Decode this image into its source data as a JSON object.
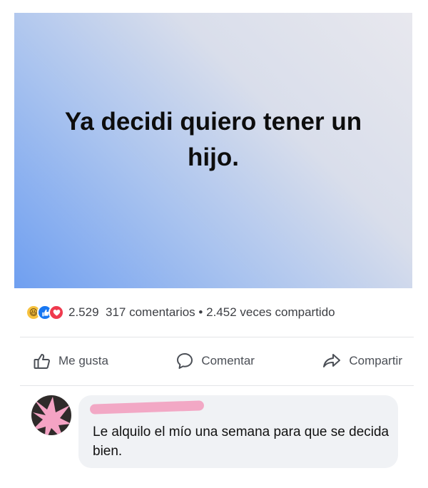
{
  "post": {
    "text": "Ya decidi quiero tener un hijo."
  },
  "stats": {
    "reaction_count": "2.529",
    "comments": "317 comentarios",
    "separator": "•",
    "shares": "2.452 veces compartido",
    "reactions": [
      "haha-icon",
      "like-icon",
      "love-icon"
    ]
  },
  "actions": {
    "like": "Me gusta",
    "comment": "Comentar",
    "share": "Compartir"
  },
  "comment": {
    "text": "Le alquilo el mío una semana para que se decida bien."
  },
  "colors": {
    "like_blue": "#1877f2",
    "love_red": "#ef3a4e",
    "haha_yellow": "#f7c23e",
    "censor_pink": "#f2a8c5"
  }
}
